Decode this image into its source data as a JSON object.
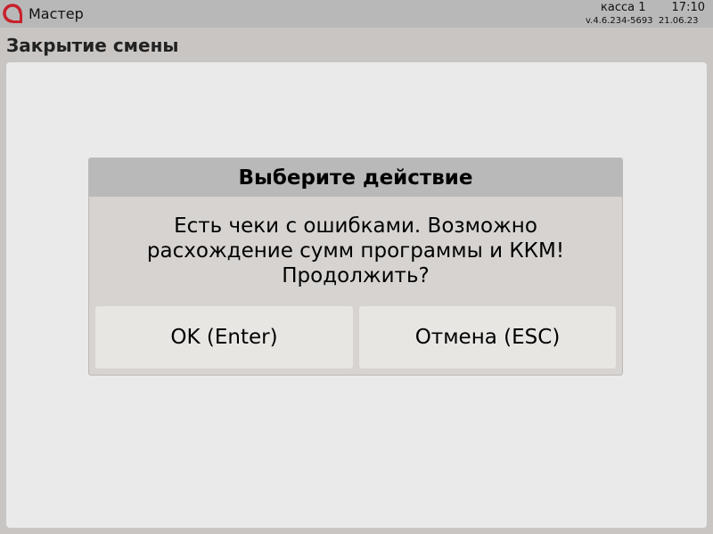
{
  "topbar": {
    "app_title": "Мастер",
    "register": "касса 1",
    "time": "17:10",
    "version": "v.4.6.234-5693",
    "date": "21.06.23",
    "logo_icon": "app-logo-icon",
    "accent_color": "#c8202c"
  },
  "page": {
    "title": "Закрытие смены"
  },
  "dialog": {
    "title": "Выберите действие",
    "message_lines": [
      "Есть чеки с ошибками. Возможно",
      "расхождение сумм программы и ККМ!",
      "Продолжить?"
    ],
    "ok_label": "OK (Enter)",
    "cancel_label": "Отмена (ESC)"
  }
}
